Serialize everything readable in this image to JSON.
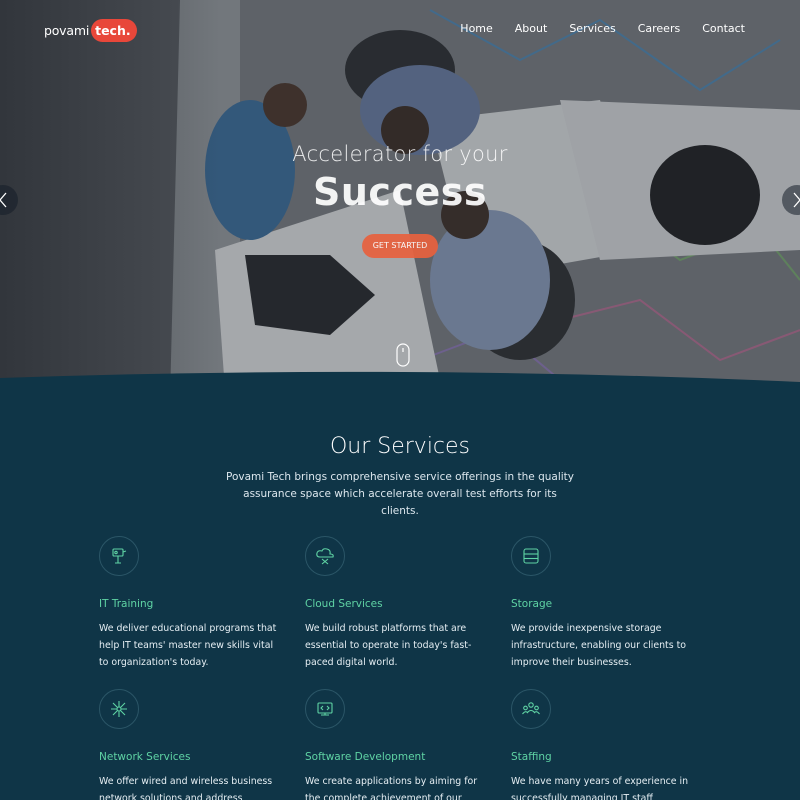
{
  "brand": {
    "name_prefix": "povami",
    "name_badge": "tech."
  },
  "nav": {
    "items": [
      {
        "label": "Home",
        "active": true
      },
      {
        "label": "About",
        "active": false
      },
      {
        "label": "Services",
        "active": false
      },
      {
        "label": "Careers",
        "active": false
      },
      {
        "label": "Contact",
        "active": false
      }
    ]
  },
  "hero": {
    "title_small": "Accelerator for your",
    "title_big": "Success",
    "cta_label": "GET STARTED"
  },
  "services": {
    "title": "Our Services",
    "description": "Povami Tech brings comprehensive service offerings in the quality assurance space which accelerate overall test efforts for its clients.",
    "items": [
      {
        "icon": "training-icon",
        "title": "IT Training",
        "text": "We deliver educational programs that help IT teams' master new skills vital to organization's today."
      },
      {
        "icon": "cloud-icon",
        "title": "Cloud Services",
        "text": "We build robust platforms that are essential to operate in today's fast-paced digital world."
      },
      {
        "icon": "storage-icon",
        "title": "Storage",
        "text": "We provide inexpensive storage infrastructure, enabling our clients to improve their businesses."
      },
      {
        "icon": "network-icon",
        "title": "Network Services",
        "text": "We offer wired and wireless business network solutions and address common"
      },
      {
        "icon": "software-icon",
        "title": "Software Development",
        "text": "We create applications by aiming for the complete achievement of our"
      },
      {
        "icon": "staffing-icon",
        "title": "Staffing",
        "text": "We have many years of experience in successfully managing IT staff"
      }
    ]
  },
  "colors": {
    "accent": "#e8473a",
    "service_title": "#5fd3a4",
    "section_bg": "#0f3547"
  }
}
